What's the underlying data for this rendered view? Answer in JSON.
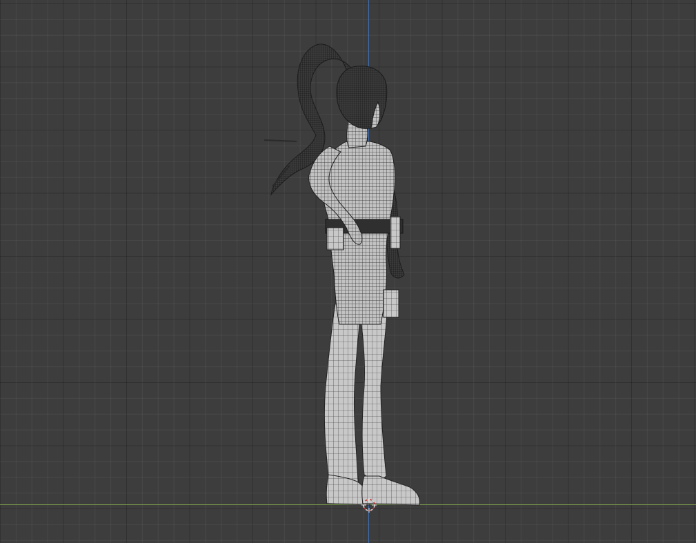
{
  "viewport": {
    "view": "side-view",
    "display_mode": "wireframe",
    "grid_visible": true,
    "colors": {
      "background": "#3d3d3d",
      "z_axis": "#3f6fb6",
      "y_axis": "#7a9c4c",
      "mesh_fill": "#c2c2c2",
      "wire": "#262626",
      "hair": "#2a2a2a",
      "cursor": "#d9d9d9",
      "cursor_accent": "#c8302c"
    }
  },
  "object": {
    "kind": "character-mesh"
  },
  "cursor_icon": "3d-cursor-icon"
}
